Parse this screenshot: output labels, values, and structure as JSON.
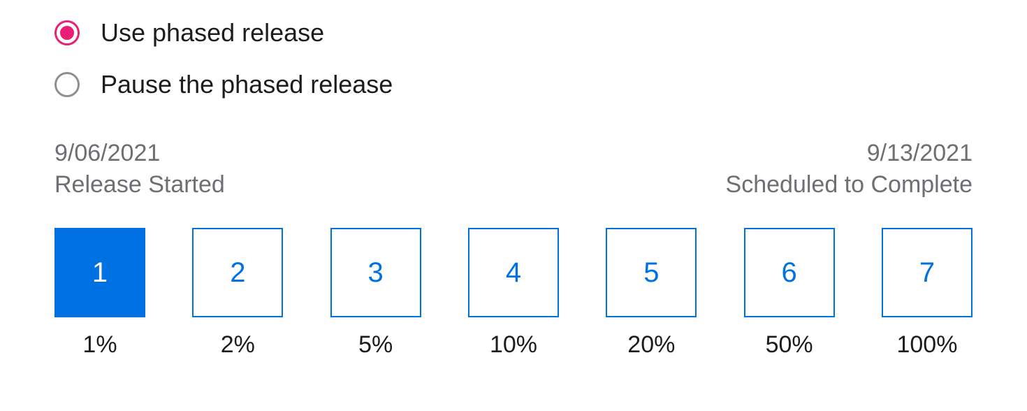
{
  "radio_options": {
    "use_phased": {
      "label": "Use phased release",
      "selected": true
    },
    "pause_phased": {
      "label": "Pause the phased release",
      "selected": false
    }
  },
  "dates": {
    "start_date": "9/06/2021",
    "start_label": "Release Started",
    "end_date": "9/13/2021",
    "end_label": "Scheduled to Complete"
  },
  "days": [
    {
      "number": "1",
      "percent": "1%",
      "active": true
    },
    {
      "number": "2",
      "percent": "2%",
      "active": false
    },
    {
      "number": "3",
      "percent": "5%",
      "active": false
    },
    {
      "number": "4",
      "percent": "10%",
      "active": false
    },
    {
      "number": "5",
      "percent": "20%",
      "active": false
    },
    {
      "number": "6",
      "percent": "50%",
      "active": false
    },
    {
      "number": "7",
      "percent": "100%",
      "active": false
    }
  ]
}
